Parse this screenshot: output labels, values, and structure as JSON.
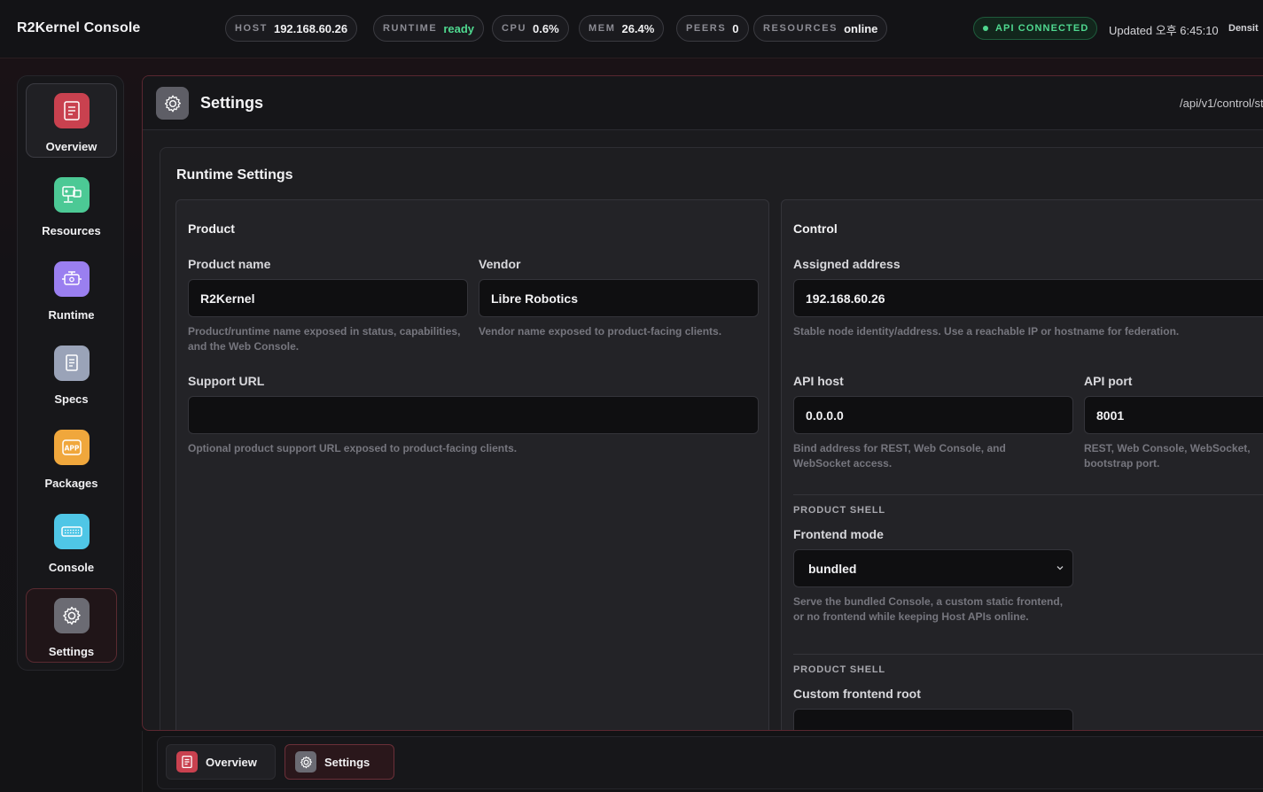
{
  "header": {
    "app_title": "R2Kernel Console",
    "chips": [
      {
        "key": "HOST",
        "value": "192.168.60.26"
      },
      {
        "key": "RUNTIME",
        "value": "ready",
        "status": "ok"
      },
      {
        "key": "CPU",
        "value": "0.6%"
      },
      {
        "key": "MEM",
        "value": "26.4%"
      },
      {
        "key": "PEERS",
        "value": "0"
      },
      {
        "key": "RESOURCES",
        "value": "online"
      }
    ],
    "api_status": "API CONNECTED",
    "updated": "Updated 오후 6:45:10",
    "density": "Densit"
  },
  "sidebar": {
    "items": [
      {
        "label": "Overview",
        "icon": "overview-doc-icon",
        "color": "#c9414f"
      },
      {
        "label": "Resources",
        "icon": "resources-network-icon",
        "color": "#4cc995"
      },
      {
        "label": "Runtime",
        "icon": "runtime-engine-icon",
        "color": "#9a7ff0"
      },
      {
        "label": "Specs",
        "icon": "specs-doc-icon",
        "color": "#9aa3b8"
      },
      {
        "label": "Packages",
        "icon": "packages-app-icon",
        "color": "#f0a73c"
      },
      {
        "label": "Console",
        "icon": "console-keyboard-icon",
        "color": "#4fc6e6"
      },
      {
        "label": "Settings",
        "icon": "gear-icon",
        "color": "#6b6b73"
      }
    ],
    "active": "Settings"
  },
  "panel": {
    "title": "Settings",
    "api_path": "/api/v1/control/st",
    "card_title": "Runtime Settings",
    "product": {
      "title": "Product",
      "product_name_label": "Product name",
      "product_name_value": "R2Kernel",
      "product_name_help": "Product/runtime name exposed in status, capabilities, and the Web Console.",
      "vendor_label": "Vendor",
      "vendor_value": "Libre Robotics",
      "vendor_help": "Vendor name exposed to product-facing clients.",
      "support_url_label": "Support URL",
      "support_url_value": "",
      "support_url_help": "Optional product support URL exposed to product-facing clients."
    },
    "control": {
      "title": "Control",
      "assigned_address_label": "Assigned address",
      "assigned_address_value": "192.168.60.26",
      "assigned_address_help": "Stable node identity/address. Use a reachable IP or hostname for federation.",
      "api_host_label": "API host",
      "api_host_value": "0.0.0.0",
      "api_host_help": "Bind address for REST, Web Console, and WebSocket access.",
      "api_port_label": "API port",
      "api_port_value": "8001",
      "api_port_help": "REST, Web Console, WebSocket, bootstrap port.",
      "section_caption_1": "PRODUCT SHELL",
      "frontend_mode_label": "Frontend mode",
      "frontend_mode_value": "bundled",
      "frontend_mode_help": "Serve the bundled Console, a custom static frontend, or no frontend while keeping Host APIs online.",
      "section_caption_2": "PRODUCT SHELL",
      "custom_root_label": "Custom frontend root",
      "custom_root_value": ""
    }
  },
  "dock": {
    "tabs": [
      {
        "label": "Overview",
        "icon": "overview-doc-icon"
      },
      {
        "label": "Settings",
        "icon": "gear-icon"
      }
    ]
  }
}
